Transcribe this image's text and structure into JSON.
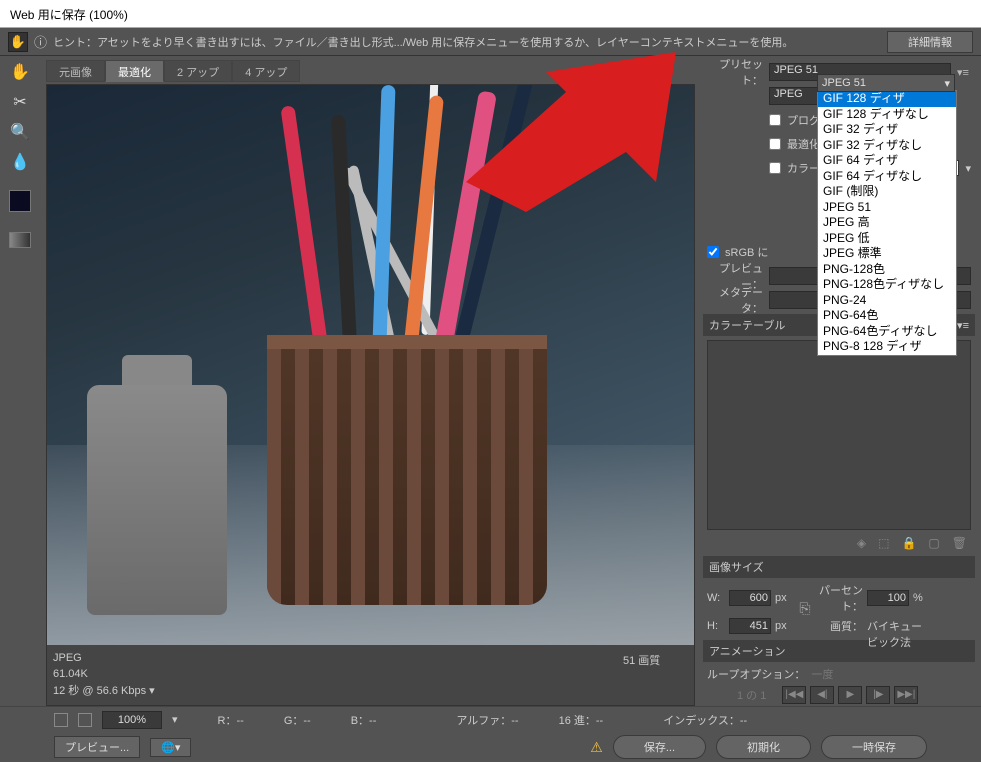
{
  "title": "Web 用に保存 (100%)",
  "hint": {
    "text": "ヒント：アセットをより早く書き出すには、ファイル／書き出し形式.../Web 用に保存メニューを使用するか、レイヤーコンテキストメニューを使用。",
    "detail_btn": "詳細情報"
  },
  "tabs": {
    "original": "元画像",
    "optimized": "最適化",
    "two_up": "2 アップ",
    "four_up": "4 アップ"
  },
  "image_info": {
    "format": "JPEG",
    "size": "61.04K",
    "time": "12 秒 @ 56.6 Kbps",
    "quality": "51 画質"
  },
  "preset": {
    "label": "プリセット：",
    "value": "JPEG 51"
  },
  "format_label": "JPEG",
  "progressive_label": "プログレ",
  "optimize_label": "最適化",
  "color_profile_label": "カラープ",
  "srgb_label": "sRGB に",
  "preview_label": "プレビュー：",
  "metadata_label": "メタデータ：",
  "dropdown_options": [
    "GIF 128 ディザ",
    "GIF 128 ディザなし",
    "GIF 32 ディザ",
    "GIF 32 ディザなし",
    "GIF 64 ディザ",
    "GIF 64 ディザなし",
    "GIF (制限)",
    "JPEG 51",
    "JPEG 高",
    "JPEG 低",
    "JPEG 標準",
    "PNG-128色",
    "PNG-128色ディザなし",
    "PNG-24",
    "PNG-64色",
    "PNG-64色ディザなし",
    "PNG-8 128 ディザ"
  ],
  "dropdown_selected": 0,
  "color_table": {
    "title": "カラーテーブル"
  },
  "image_size": {
    "title": "画像サイズ",
    "w_label": "W:",
    "w_value": "600",
    "px": "px",
    "h_label": "H:",
    "h_value": "451",
    "percent_label": "パーセント：",
    "percent_value": "100",
    "percent_unit": "%",
    "quality_label": "画質：",
    "quality_value": "バイキュービック法"
  },
  "animation": {
    "title": "アニメーション",
    "loop_label": "ループオプション：",
    "loop_value": "一度",
    "frame": "1 の 1"
  },
  "bottom": {
    "zoom": "100%",
    "r": "R：--",
    "g": "G：--",
    "b": "B：--",
    "alpha": "アルファ：--",
    "hex": "16 進：--",
    "index": "インデックス：--",
    "preview_btn": "プレビュー...",
    "save": "保存...",
    "reset": "初期化",
    "temp": "一時保存"
  }
}
